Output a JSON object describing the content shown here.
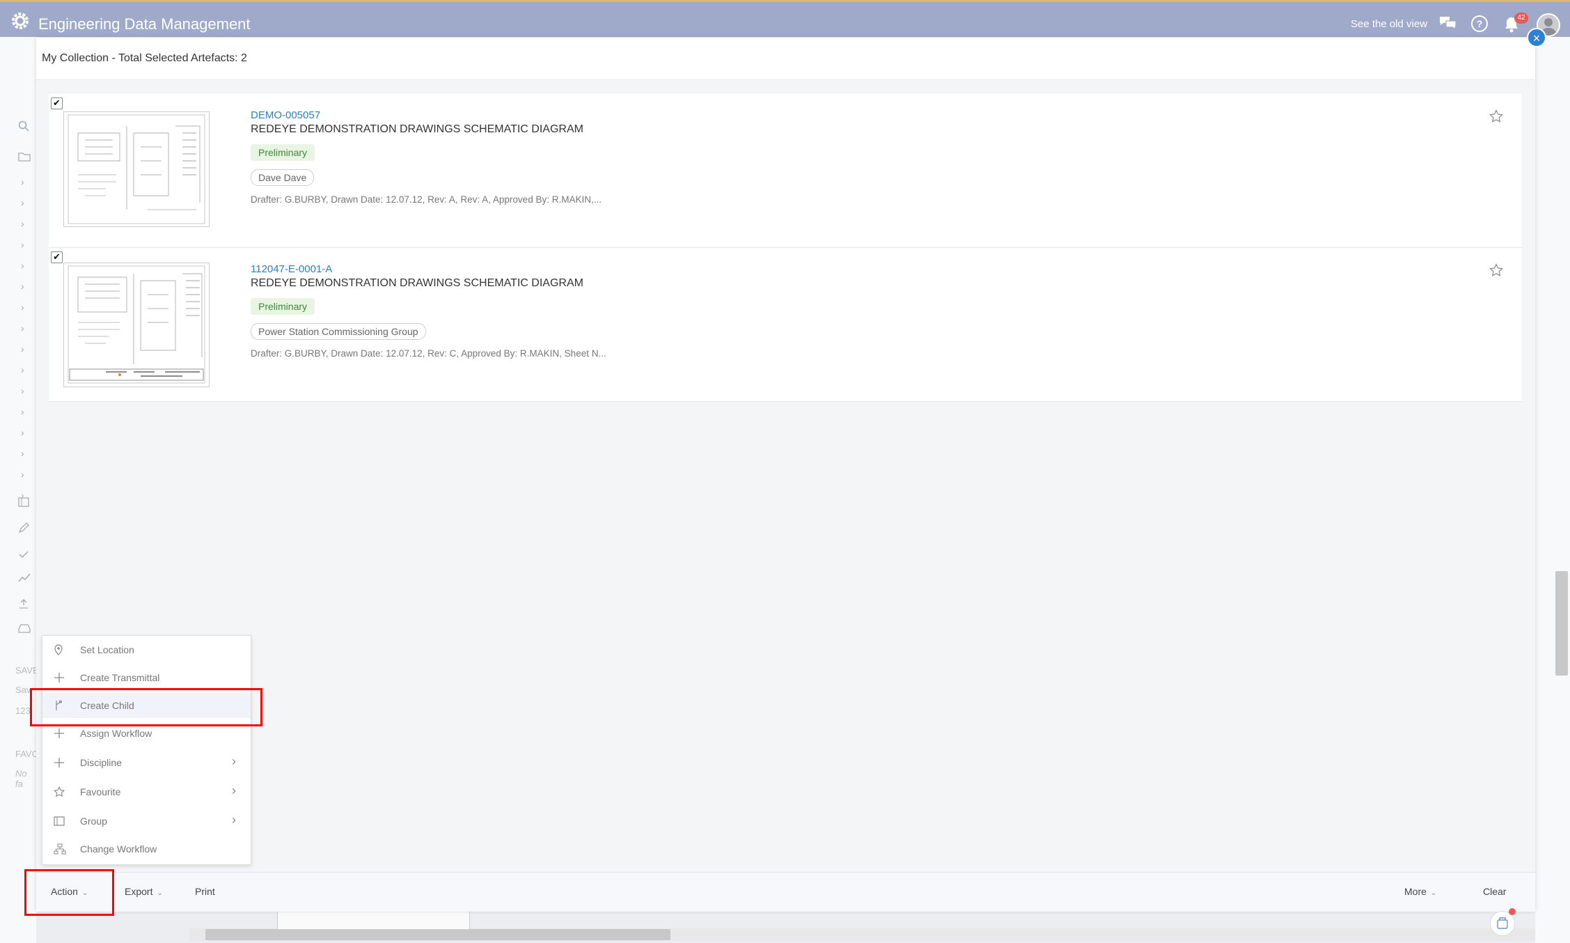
{
  "app": {
    "title": "Engineering Data Management",
    "old_view_link": "See the old view",
    "notification_count": "42"
  },
  "modal": {
    "title": "My Collection - Total Selected Artefacts: 2",
    "artefacts": [
      {
        "id": "DEMO-005057",
        "title": "REDEYE DEMONSTRATION DRAWINGS SCHEMATIC DIAGRAM",
        "status": "Preliminary",
        "group": "Dave Dave",
        "meta": "Drafter: G.BURBY, Drawn Date: 12.07.12, Rev: A, Rev: A, Approved By: R.MAKIN,...",
        "checked": true
      },
      {
        "id": "112047-E-0001-A",
        "title": "REDEYE DEMONSTRATION DRAWINGS SCHEMATIC DIAGRAM",
        "status": "Preliminary",
        "group": "Power Station Commissioning Group",
        "meta": "Drafter: G.BURBY, Drawn Date: 12.07.12, Rev: C, Approved By: R.MAKIN, Sheet N...",
        "checked": true
      }
    ]
  },
  "action_menu": {
    "items": [
      {
        "label": "Set Location",
        "icon": "location-pin-icon",
        "submenu": false
      },
      {
        "label": "Create Transmittal",
        "icon": "plus-icon",
        "submenu": false
      },
      {
        "label": "Create Child",
        "icon": "branch-icon",
        "submenu": false,
        "highlighted": true
      },
      {
        "label": "Assign Workflow",
        "icon": "plus-icon",
        "submenu": false
      },
      {
        "label": "Discipline",
        "icon": "plus-icon",
        "submenu": true
      },
      {
        "label": "Favourite",
        "icon": "star-icon",
        "submenu": true
      },
      {
        "label": "Group",
        "icon": "group-icon",
        "submenu": true
      },
      {
        "label": "Change Workflow",
        "icon": "workflow-icon",
        "submenu": false
      }
    ]
  },
  "action_bar": {
    "action_label": "Action",
    "export_label": "Export",
    "print_label": "Print",
    "more_label": "More",
    "clear_label": "Clear"
  },
  "background": {
    "sidebar_sections": [
      "SAVE",
      "Sav",
      "123",
      "FAVO",
      "No fa"
    ]
  },
  "colors": {
    "topbar": "#9faacb",
    "accent": "#2b7fc2",
    "highlight_box": "#ff0000",
    "status_green": "#3a8a3a"
  }
}
